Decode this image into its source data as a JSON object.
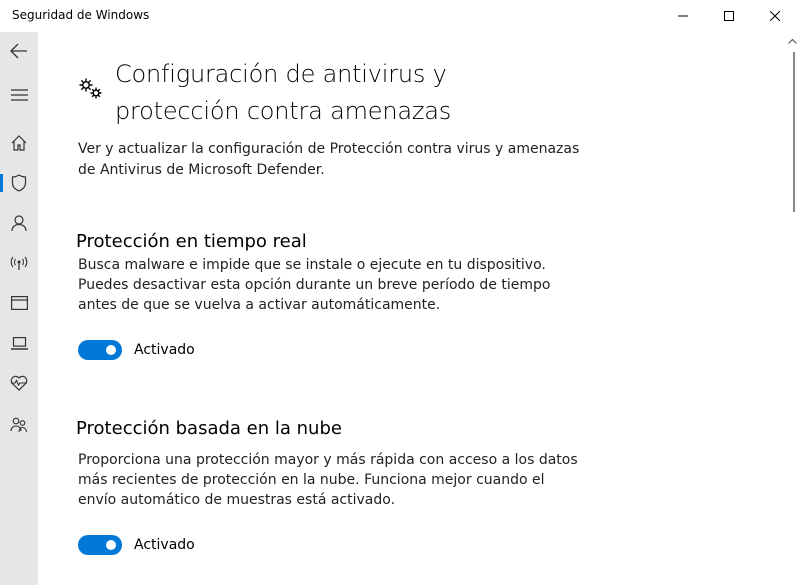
{
  "window": {
    "title": "Seguridad de Windows",
    "controls": {
      "minimize_icon": "minimize-icon",
      "maximize_icon": "maximize-icon",
      "close_icon": "close-icon"
    }
  },
  "sidebar": {
    "items": [
      {
        "name": "back",
        "icon": "back-arrow-icon"
      },
      {
        "name": "menu",
        "icon": "hamburger-menu-icon"
      },
      {
        "name": "home",
        "icon": "home-icon"
      },
      {
        "name": "virus-protection",
        "icon": "shield-icon",
        "active": true
      },
      {
        "name": "account-protection",
        "icon": "person-icon"
      },
      {
        "name": "firewall",
        "icon": "antenna-icon"
      },
      {
        "name": "app-browser-control",
        "icon": "browser-window-icon"
      },
      {
        "name": "device-security",
        "icon": "laptop-icon"
      },
      {
        "name": "device-performance",
        "icon": "heart-pulse-icon"
      },
      {
        "name": "family-options",
        "icon": "family-icon"
      }
    ],
    "accent_color": "#0078d7"
  },
  "page": {
    "title": "Configuración de antivirus y protección contra amenazas",
    "description": "Ver y actualizar la configuración de Protección contra virus y amenazas de Antivirus de Microsoft Defender.",
    "icon": "gears-icon"
  },
  "sections": [
    {
      "title": "Protección en tiempo real",
      "description": "Busca malware e impide que se instale o ejecute en tu dispositivo. Puedes desactivar esta opción durante un breve período de tiempo antes de que se vuelva a activar automáticamente.",
      "toggle": {
        "state": "on",
        "label": "Activado"
      }
    },
    {
      "title": "Protección basada en la nube",
      "description": "Proporciona una protección mayor y más rápida con acceso a los datos más recientes de protección en la nube. Funciona mejor cuando el envío automático de muestras está activado.",
      "toggle": {
        "state": "on",
        "label": "Activado"
      }
    }
  ],
  "colors": {
    "toggle_on": "#0078d7",
    "sidebar_bg": "#e6e6e6"
  }
}
